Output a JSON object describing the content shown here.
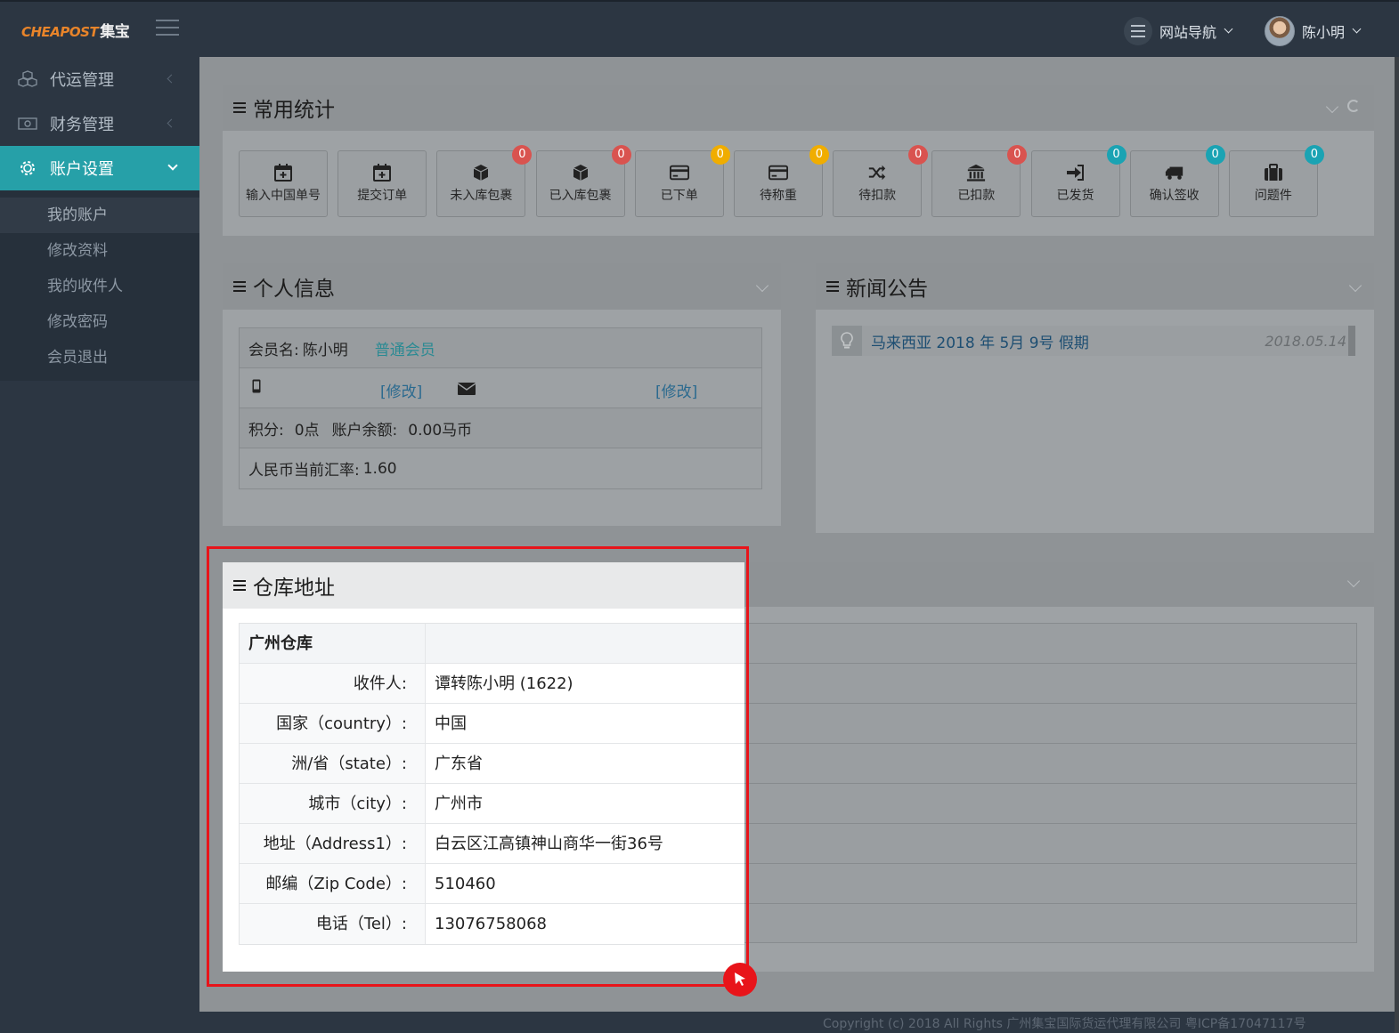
{
  "header": {
    "logo_en": "CHEAPOST",
    "logo_cn": "集宝",
    "site_nav_label": "网站导航",
    "user_name": "陈小明"
  },
  "sidebar": {
    "items": [
      {
        "label": "代运管理"
      },
      {
        "label": "财务管理"
      },
      {
        "label": "账户设置"
      }
    ],
    "submenu": [
      {
        "label": "我的账户"
      },
      {
        "label": "修改资料"
      },
      {
        "label": "我的收件人"
      },
      {
        "label": "修改密码"
      },
      {
        "label": "会员退出"
      }
    ]
  },
  "stats": {
    "title": "常用统计",
    "buttons": [
      {
        "label": "输入中国单号",
        "icon": "calendar-plus-icon"
      },
      {
        "label": "提交订单",
        "icon": "calendar-plus-icon"
      },
      {
        "label": "未入库包裹",
        "icon": "cube-icon",
        "count": "0",
        "badge_color": "#d9534f"
      },
      {
        "label": "已入库包裹",
        "icon": "cube-icon",
        "count": "0",
        "badge_color": "#d9534f"
      },
      {
        "label": "已下单",
        "icon": "credit-card-icon",
        "count": "0",
        "badge_color": "#f0ad00"
      },
      {
        "label": "待称重",
        "icon": "credit-card-icon",
        "count": "0",
        "badge_color": "#f0ad00"
      },
      {
        "label": "待扣款",
        "icon": "shuffle-icon",
        "count": "0",
        "badge_color": "#d9534f"
      },
      {
        "label": "已扣款",
        "icon": "bank-icon",
        "count": "0",
        "badge_color": "#d9534f"
      },
      {
        "label": "已发货",
        "icon": "sign-in-icon",
        "count": "0",
        "badge_color": "#1aa3b3"
      },
      {
        "label": "确认签收",
        "icon": "truck-icon",
        "count": "0",
        "badge_color": "#1aa3b3"
      },
      {
        "label": "问题件",
        "icon": "briefcase-icon",
        "count": "0",
        "badge_color": "#1aa3b3"
      }
    ]
  },
  "profile": {
    "title": "个人信息",
    "member_label": "会员名:",
    "member_name": "陈小明",
    "member_level": "普通会员",
    "edit_label": "[修改]",
    "points_label": "积分:",
    "points_value": "0点",
    "balance_label": "账户余额:",
    "balance_value": "0.00马币",
    "rate_label": "人民币当前汇率:",
    "rate_value": "1.60"
  },
  "news": {
    "title": "新闻公告",
    "items": [
      {
        "title": "马来西亚 2018 年 5月 9号 假期",
        "date": "2018.05.14"
      }
    ]
  },
  "warehouse": {
    "title": "仓库地址",
    "name": "广州仓库",
    "rows": [
      {
        "label": "收件人:",
        "value": "谭转陈小明 (1622)"
      },
      {
        "label": "国家（country）:",
        "value": "中国"
      },
      {
        "label": "洲/省（state）:",
        "value": "广东省"
      },
      {
        "label": "城市（city）:",
        "value": "广州市"
      },
      {
        "label": "地址（Address1）:",
        "value": "白云区江高镇神山商华一街36号"
      },
      {
        "label": "邮编（Zip Code）:",
        "value": "510460"
      },
      {
        "label": "电话（Tel）:",
        "value": "13076758068"
      }
    ]
  },
  "footer": {
    "text": "Copyright (c) 2018 All Rights 广州集宝国际货运代理有限公司 粤ICP备17047117号"
  },
  "colors": {
    "accent": "#26a0a8",
    "highlight": "#e8141a"
  }
}
